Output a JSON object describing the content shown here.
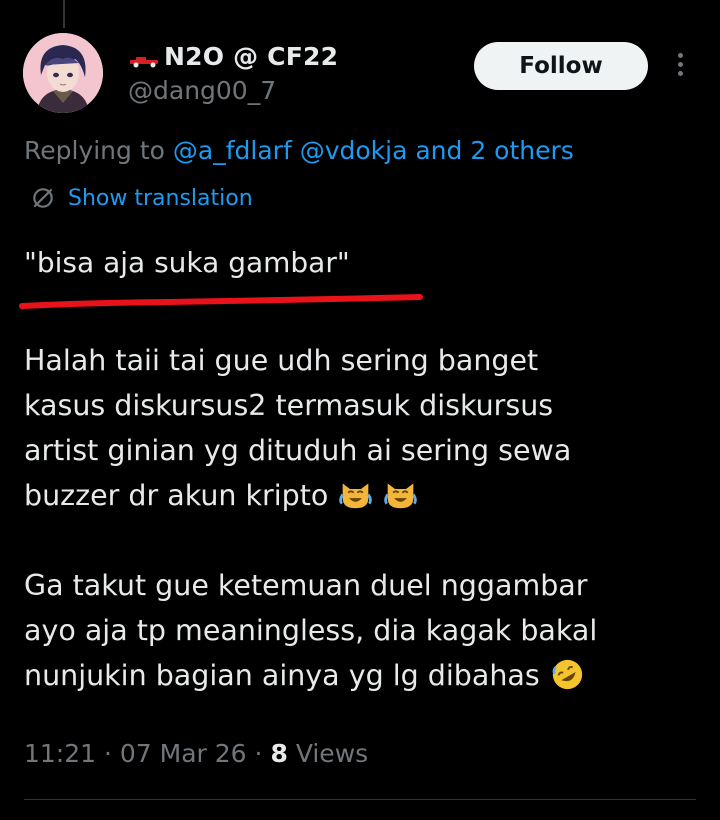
{
  "author": {
    "display_name": "N2O @ CF22",
    "handle": "@dang00_7",
    "avatar_icon": "avatar-anime-character",
    "badge_icon": "red-race-car-icon"
  },
  "follow_label": "Follow",
  "more_icon": "more-vertical-icon",
  "reply_context": {
    "prefix": "Replying to",
    "mentions": "@a_fdlarf @vdokja and 2 others"
  },
  "translation": {
    "label": "Show translation",
    "icon": "translate-slash-icon"
  },
  "quote_text": "\"bisa aja suka gambar\"",
  "annotation_color": "#e8121a",
  "body": {
    "line1": "Halah taii tai gue udh sering banget",
    "line2": "kasus diskursus2 termasuk diskursus",
    "line3": "artist ginian yg dituduh ai sering sewa",
    "line4": "buzzer dr akun kripto",
    "line4_emojis": [
      "cat-tears-of-joy-emoji",
      "cat-tears-of-joy-emoji"
    ],
    "line5": "Ga takut gue ketemuan duel nggambar",
    "line6": "ayo aja tp meaningless, dia kagak bakal",
    "line7": "nunjukin bagian ainya yg lg dibahas",
    "line7_emoji": "rolling-on-floor-laughing-emoji"
  },
  "meta": {
    "time": "11:21",
    "date": "07 Mar 26",
    "views_count": "8",
    "views_label": "Views"
  },
  "colors": {
    "background": "#000000",
    "text": "#e7e9ea",
    "secondary": "#71767b",
    "link": "#1d9bf0",
    "follow_bg": "#eff3f4"
  }
}
